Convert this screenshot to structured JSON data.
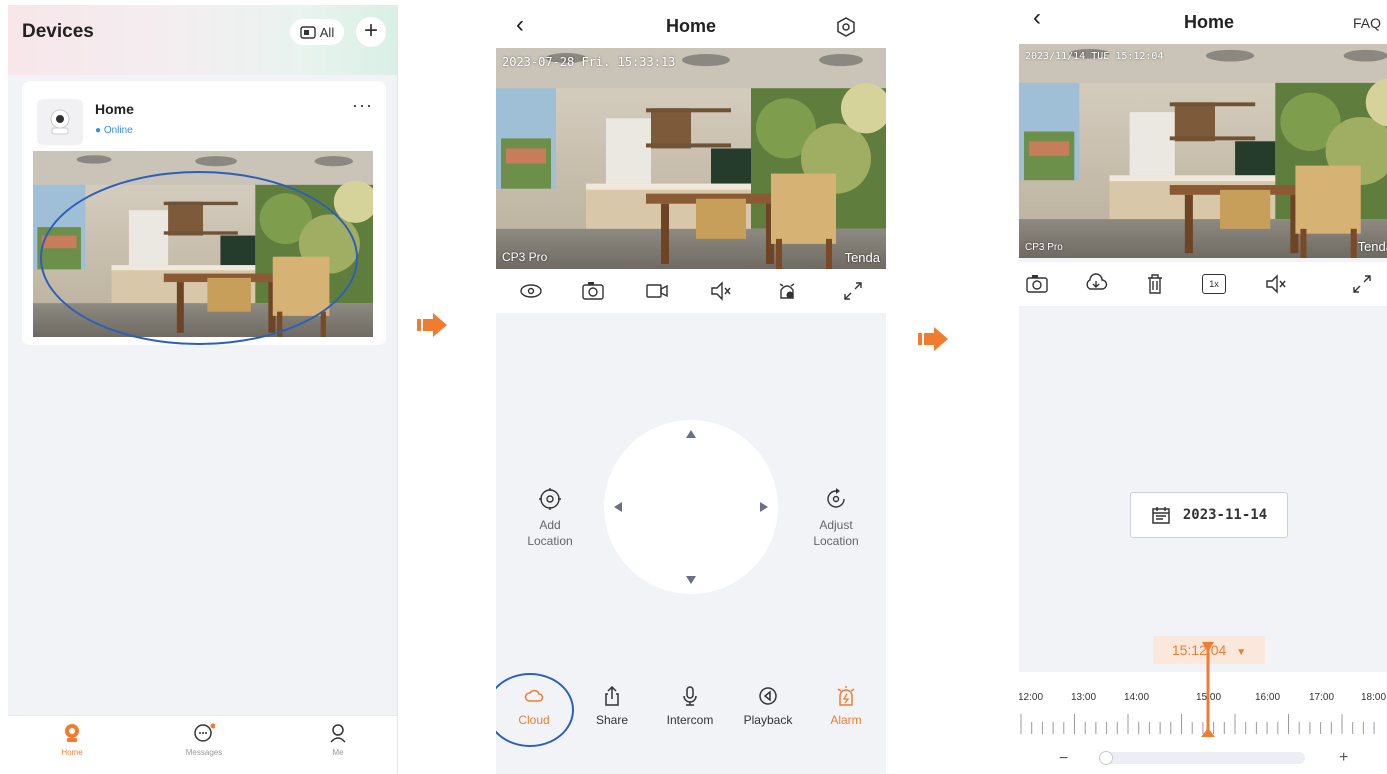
{
  "devices_screen": {
    "title": "Devices",
    "all_button": "All",
    "device": {
      "name": "Home",
      "status": "Online"
    },
    "tabs": [
      {
        "label": "Home",
        "icon": "home-camera-icon",
        "active": true
      },
      {
        "label": "Messages",
        "icon": "messages-icon",
        "badge": true
      },
      {
        "label": "Me",
        "icon": "me-icon"
      }
    ]
  },
  "live_screen": {
    "title": "Home",
    "osd_time": "2023-07-28 Fri.  15:33:13",
    "osd_model": "CP3 Pro",
    "osd_brand": "Tenda",
    "controls": [
      "eye-icon",
      "snapshot-icon",
      "record-icon",
      "mute-icon",
      "alarm-touch-icon",
      "fullscreen-icon"
    ],
    "add_location": {
      "line1": "Add",
      "line2": "Location"
    },
    "adjust_location": {
      "line1": "Adjust",
      "line2": "Location"
    },
    "bottom_buttons": [
      {
        "label": "Cloud",
        "icon": "cloud-icon",
        "color": "#f07d2f"
      },
      {
        "label": "Share",
        "icon": "share-icon",
        "color": "#333333"
      },
      {
        "label": "Intercom",
        "icon": "microphone-icon",
        "color": "#333333"
      },
      {
        "label": "Playback",
        "icon": "playback-icon",
        "color": "#333333"
      },
      {
        "label": "Alarm",
        "icon": "alarm-icon",
        "color": "#f07d2f"
      }
    ]
  },
  "playback_screen": {
    "title": "Home",
    "faq": "FAQ",
    "osd_time": "2023/11/14 TUE  15:12:04",
    "osd_model": "CP3 Pro",
    "osd_brand": "Tenda",
    "controls": [
      "snapshot-icon",
      "download-icon",
      "delete-icon",
      "speed-1x-icon",
      "mute-icon",
      "fullscreen-icon"
    ],
    "speed": "1x",
    "date": "2023-11-14",
    "current_time": "15:12:04",
    "timeline_labels": [
      "12:00",
      "13:00",
      "14:00",
      "15:00",
      "16:00",
      "17:00",
      "18:00"
    ],
    "zoom_minus": "−",
    "zoom_plus": "+"
  },
  "colors": {
    "accent": "#f07d2f",
    "highlight": "#2e5fb8",
    "online": "#3b8de0"
  }
}
